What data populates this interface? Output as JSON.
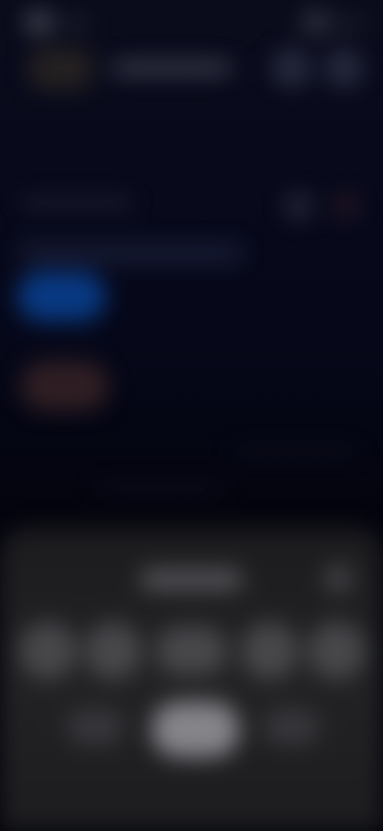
{
  "screen": {
    "state": "blurred",
    "background_color": "#05060f",
    "sheet_color": "#1f1f22",
    "accent_blue": "#0a5ac8",
    "accent_brown": "#643c32"
  },
  "status_bar": {
    "left_indicator_icon": "status-dot-icon",
    "right_indicator_icon": "status-dot-icon"
  },
  "header": {
    "avatar_icon": "avatar-icon",
    "action_icons": [
      "circle-button-icon",
      "circle-button-icon"
    ]
  },
  "section": {
    "action_icons": [
      "circle-icon",
      "circle-icon"
    ]
  },
  "cards": {
    "first_color": "#0a5ac8",
    "second_color": "#643c32"
  },
  "sheet": {
    "close_icon": "close-icon",
    "round_buttons": [
      "round-button-icon",
      "round-button-icon",
      "round-button-icon",
      "round-button-icon",
      "round-button-icon"
    ],
    "secondary_buttons": [
      "pill-button-icon",
      "pill-button-icon"
    ]
  }
}
